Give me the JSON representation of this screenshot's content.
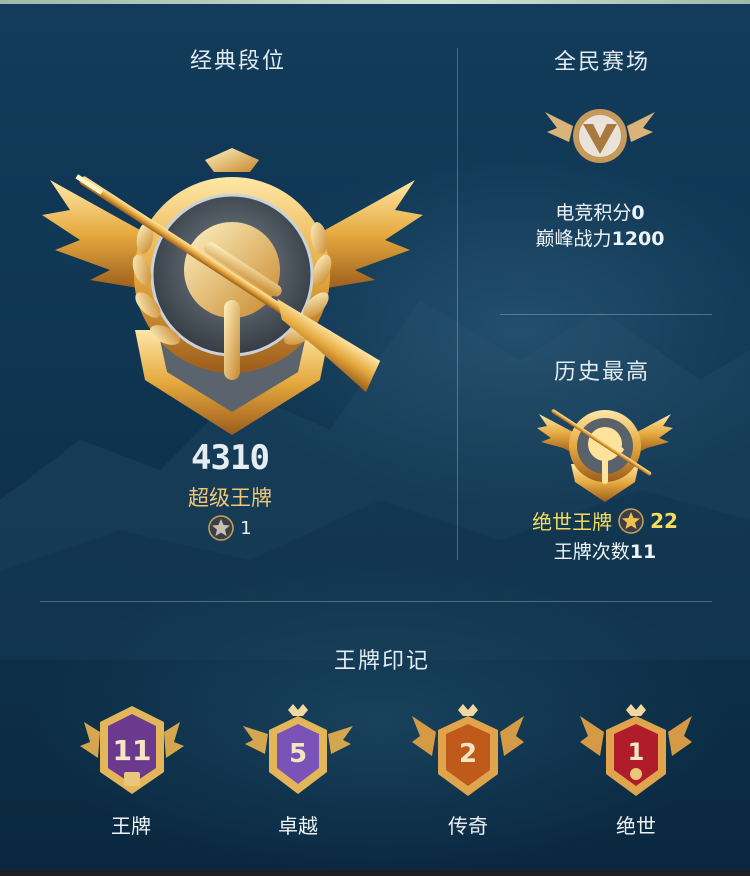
{
  "classic": {
    "title": "经典段位",
    "score": "4310",
    "tier": "超级王牌",
    "stars": "1"
  },
  "arena": {
    "title": "全民赛场",
    "esports_label": "电竞积分",
    "esports_value": "0",
    "peak_label": "巅峰战力",
    "peak_value": "1200"
  },
  "history": {
    "title": "历史最高",
    "tier": "绝世王牌",
    "stars": "22",
    "ace_count_label": "王牌次数",
    "ace_count_value": "11"
  },
  "marks": {
    "title": "王牌印记",
    "items": [
      {
        "label": "王牌",
        "count": "11",
        "color": "#6b3a8f"
      },
      {
        "label": "卓越",
        "count": "5",
        "color": "#7a52b8"
      },
      {
        "label": "传奇",
        "count": "2",
        "color": "#c05a1a"
      },
      {
        "label": "绝世",
        "count": "1",
        "color": "#b01c2a"
      }
    ]
  },
  "colors": {
    "gold": "#e9b54a",
    "gold_light": "#ffe39a",
    "tier_text": "#f2c77a",
    "highlight_text": "#f5dc5a"
  },
  "icons": {
    "main_badge": "ace-rank-badge-icon",
    "arena_badge": "arena-rank-badge-icon",
    "history_badge": "history-rank-badge-icon",
    "star": "star-icon"
  }
}
